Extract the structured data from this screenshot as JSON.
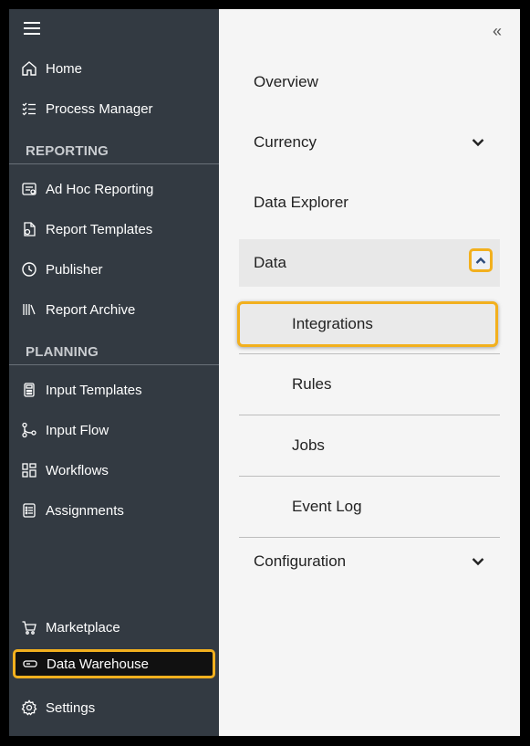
{
  "sidebar": {
    "menu_toggle_icon": "hamburger-icon",
    "items_top": [
      {
        "label": "Home",
        "icon": "home-icon"
      },
      {
        "label": "Process Manager",
        "icon": "checklist-icon"
      }
    ],
    "sections": [
      {
        "title": "REPORTING",
        "items": [
          {
            "label": "Ad Hoc Reporting",
            "icon": "adhoc-report-icon"
          },
          {
            "label": "Report Templates",
            "icon": "report-template-icon"
          },
          {
            "label": "Publisher",
            "icon": "clock-icon"
          },
          {
            "label": "Report Archive",
            "icon": "archive-icon"
          }
        ]
      },
      {
        "title": "PLANNING",
        "items": [
          {
            "label": "Input Templates",
            "icon": "calculator-icon"
          },
          {
            "label": "Input Flow",
            "icon": "flow-icon"
          },
          {
            "label": "Workflows",
            "icon": "workflow-icon"
          },
          {
            "label": "Assignments",
            "icon": "assignments-icon"
          }
        ]
      }
    ],
    "items_bottom": [
      {
        "label": "Marketplace",
        "icon": "cart-icon"
      },
      {
        "label": "Data Warehouse",
        "icon": "warehouse-icon",
        "active": true
      },
      {
        "label": "Settings",
        "icon": "gear-icon"
      }
    ]
  },
  "panel": {
    "collapse_glyph": "«",
    "items": [
      {
        "label": "Overview"
      },
      {
        "label": "Currency",
        "chevron": "down"
      },
      {
        "label": "Data Explorer"
      },
      {
        "label": "Data",
        "chevron": "up",
        "expanded": true,
        "children": [
          {
            "label": "Integrations",
            "highlighted": true
          },
          {
            "label": "Rules"
          },
          {
            "label": "Jobs"
          },
          {
            "label": "Event Log"
          }
        ]
      },
      {
        "label": "Configuration",
        "chevron": "down"
      }
    ]
  },
  "colors": {
    "sidebar_bg": "#333a42",
    "panel_bg": "#f5f5f5",
    "highlight": "#f2b01e"
  }
}
